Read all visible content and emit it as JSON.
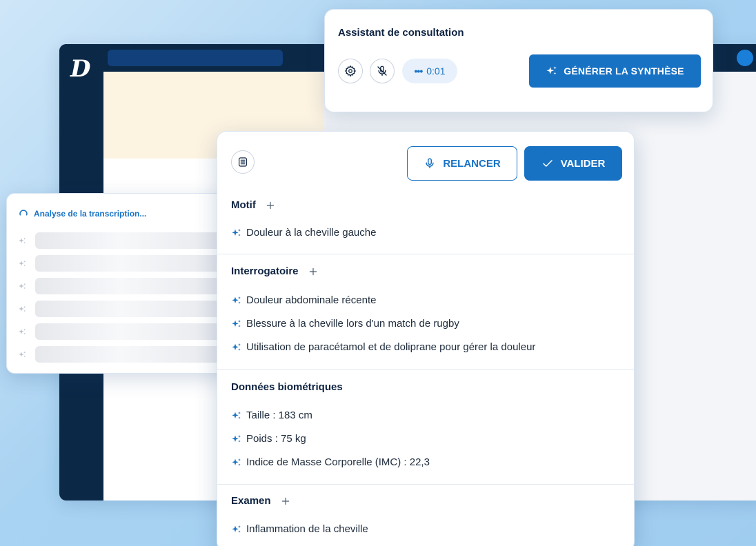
{
  "app": {
    "logo_letter": "D"
  },
  "assistant": {
    "title": "Assistant de consultation",
    "timer": "0:01",
    "timer_dots": "•••",
    "generate_label": "GÉNÉRER LA SYNTHÈSE",
    "icons": [
      "gear-icon",
      "mic-off-icon",
      "sparkle-icon"
    ]
  },
  "transcription": {
    "status": "Analyse de la transcription...",
    "skeleton_rows": 6
  },
  "synthesis": {
    "relancer_label": "RELANCER",
    "valider_label": "VALIDER",
    "sections": [
      {
        "title": "Motif",
        "has_add": true,
        "items": [
          "Douleur à la cheville gauche"
        ]
      },
      {
        "title": "Interrogatoire",
        "has_add": true,
        "items": [
          "Douleur abdominale récente",
          "Blessure à la cheville lors d'un match de rugby",
          "Utilisation de paracétamol et de doliprane pour gérer la douleur"
        ]
      },
      {
        "title": "Données biométriques",
        "has_add": false,
        "items": [
          "Taille : 183 cm",
          "Poids : 75 kg",
          "Indice de Masse Corporelle (IMC) : 22,3"
        ]
      },
      {
        "title": "Examen",
        "has_add": true,
        "items": [
          "Inflammation de la cheville"
        ]
      }
    ]
  },
  "colors": {
    "accent": "#1872c4",
    "navy": "#0c2847",
    "background": "#a9d3f2"
  }
}
